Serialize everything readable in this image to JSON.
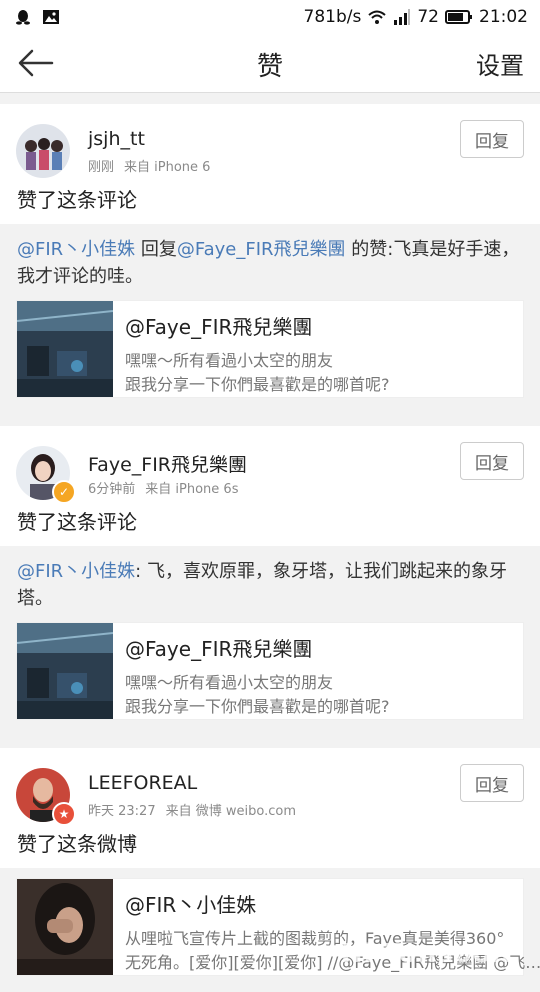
{
  "status_bar": {
    "speed": "781b/s",
    "battery": "72",
    "time": "21:02",
    "left_icons": [
      "qq-icon",
      "image-icon"
    ]
  },
  "nav": {
    "title": "赞",
    "settings_label": "设置"
  },
  "cards": [
    {
      "username": "jsjh_tt",
      "time": "刚刚",
      "source": "来自 iPhone 6",
      "reply_label": "回复",
      "action": "赞了这条评论",
      "quote": {
        "mention1": "@FIR丶小佳姝",
        "reply_word": " 回复",
        "mention2": "@Faye_FIR飛兒樂團",
        "rest": " 的赞:飞真是好手速，我才评论的哇。"
      },
      "ref": {
        "title": "@Faye_FIR飛兒樂團",
        "line1": "嘿嘿～所有看過小太空的朋友",
        "line2": "跟我分享一下你們最喜歡是的哪首呢?"
      }
    },
    {
      "username": "Faye_FIR飛兒樂團",
      "time": "6分钟前",
      "source": "来自 iPhone 6s",
      "reply_label": "回复",
      "action": "赞了这条评论",
      "quote": {
        "mention1": "@FIR丶小佳姝",
        "rest": ": 飞，喜欢原罪，象牙塔，让我们跳起来的象牙塔。"
      },
      "ref": {
        "title": "@Faye_FIR飛兒樂團",
        "line1": "嘿嘿～所有看過小太空的朋友",
        "line2": "跟我分享一下你們最喜歡是的哪首呢?"
      }
    },
    {
      "username": "LEEFOREAL",
      "time": "昨天 23:27",
      "source": "来自 微博 weibo.com",
      "reply_label": "回复",
      "action": "赞了这条微博",
      "ref": {
        "title": "@FIR丶小佳姝",
        "line1": "从哩啦飞宣传片上截的图裁剪的，Faye真是美得360°",
        "line2": "无死角。[爱你][爱你][爱你] //@Faye_FIR飛兒樂團 @飞…"
      }
    }
  ],
  "watermark": "Hi  Tonsoon"
}
